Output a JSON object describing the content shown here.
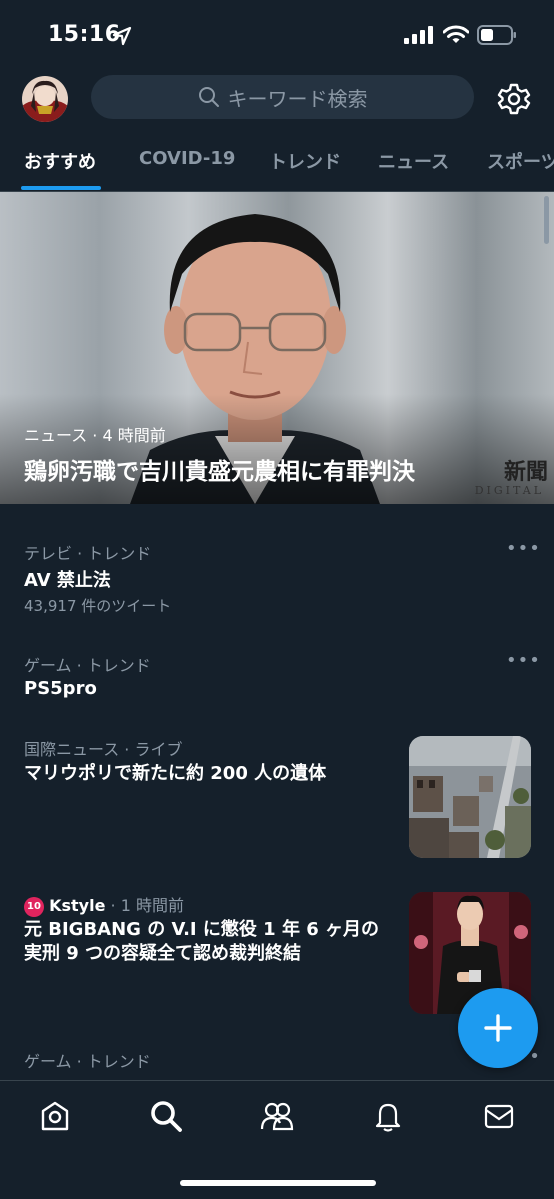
{
  "status_bar": {
    "time": "15:16"
  },
  "search": {
    "placeholder": "キーワード検索"
  },
  "tabs": [
    {
      "label": "おすすめ",
      "active": true
    },
    {
      "label": "COVID-19",
      "active": false
    },
    {
      "label": "トレンド",
      "active": false
    },
    {
      "label": "ニュース",
      "active": false
    },
    {
      "label": "スポーツ",
      "active": false
    }
  ],
  "hero": {
    "meta": "ニュース · 4 時間前",
    "title": "鶏卵汚職で吉川貴盛元農相に有罪判決",
    "source_top": "新聞",
    "source_bottom": "DIGITAL"
  },
  "trends": [
    {
      "context": "テレビ · トレンド",
      "title": "AV 禁止法",
      "count": "43,917 件のツイート",
      "more": "•••"
    },
    {
      "context": "ゲーム · トレンド",
      "title": "PS5pro",
      "more": "•••"
    }
  ],
  "news": [
    {
      "context": "国際ニュース · ライブ",
      "title": "マリウポリで新たに約 200 人の遺体"
    },
    {
      "source_logo": "10",
      "source": "Kstyle",
      "time": " · 1 時間前",
      "title": "元 BIGBANG の V.I に懲役 1 年 6 ヶ月の実刑 9 つの容疑全て認め裁判終結"
    }
  ],
  "partial_trend": {
    "context": "ゲーム · トレンド",
    "more": "•••"
  },
  "colors": {
    "background": "#15202b",
    "accent": "#1d9bf0",
    "muted": "#8b98a5"
  }
}
